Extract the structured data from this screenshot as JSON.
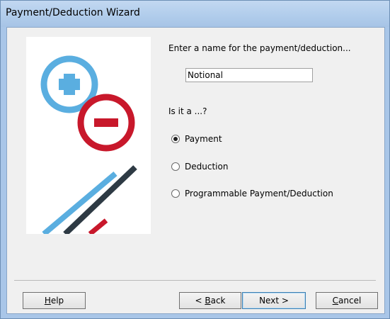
{
  "window": {
    "title": "Payment/Deduction Wizard"
  },
  "form": {
    "name_prompt": "Enter a name for the payment/deduction...",
    "name_value": "Notional",
    "type_question": "Is it a ...?",
    "options": [
      {
        "label": "Payment",
        "checked": true
      },
      {
        "label": "Deduction",
        "checked": false
      },
      {
        "label": "Programmable Payment/Deduction",
        "checked": false
      }
    ]
  },
  "buttons": {
    "help": {
      "label": "Help",
      "mnemonic": "H",
      "rest": "elp"
    },
    "back": {
      "label": "< Back",
      "prefix": "< ",
      "mnemonic": "B",
      "rest": "ack"
    },
    "next": {
      "label": "Next >"
    },
    "cancel": {
      "label": "Cancel",
      "mnemonic": "C",
      "rest": "ancel"
    }
  },
  "art": {
    "plus_color": "#5aaee0",
    "minus_color": "#c8182b",
    "stripe_light": "#5aaee0",
    "stripe_dark": "#2e3a44",
    "stripe_red": "#c8182b"
  }
}
